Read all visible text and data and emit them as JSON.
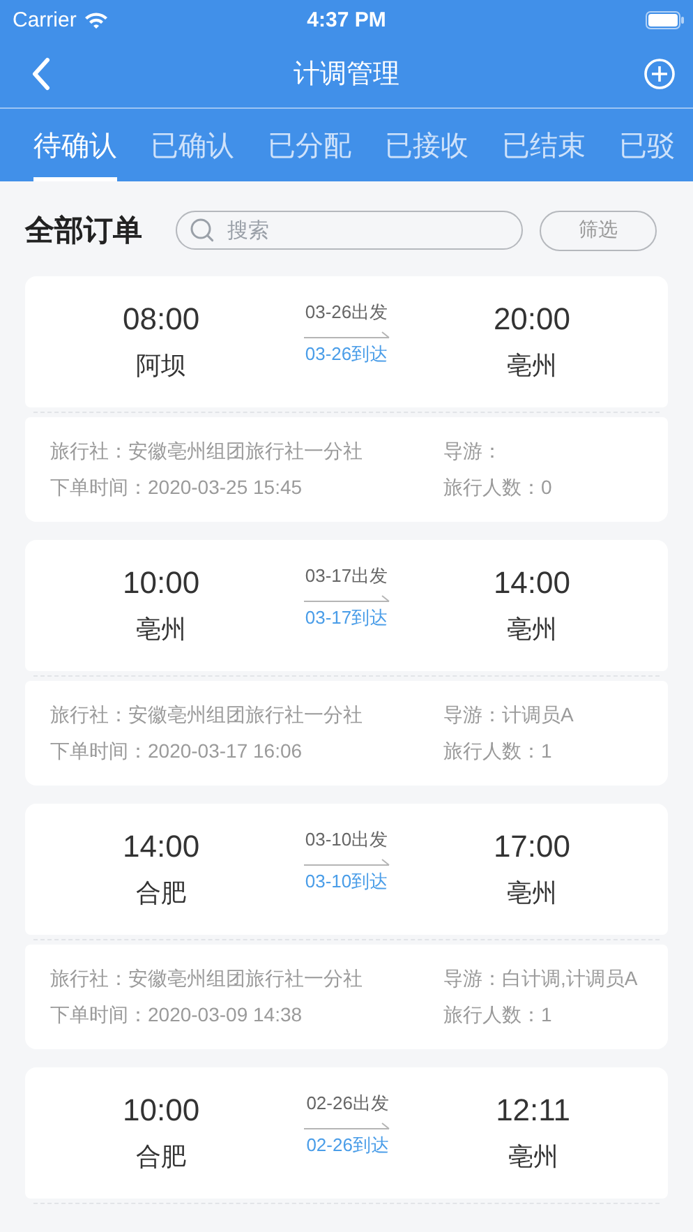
{
  "status_bar": {
    "carrier": "Carrier",
    "time": "4:37 PM"
  },
  "nav": {
    "title": "计调管理"
  },
  "tabs": [
    {
      "label": "待确认",
      "selected": true
    },
    {
      "label": "已确认",
      "selected": false
    },
    {
      "label": "已分配",
      "selected": false
    },
    {
      "label": "已接收",
      "selected": false
    },
    {
      "label": "已结束",
      "selected": false
    },
    {
      "label": "已驳",
      "selected": false
    }
  ],
  "header": {
    "title": "全部订单",
    "search": {
      "placeholder": "搜索"
    },
    "filter": "筛选"
  },
  "orders": [
    {
      "depart_time": "08:00",
      "from": "阿坝",
      "depart_date": "03-26出发",
      "arrive_date": "03-26到达",
      "arrive_time": "20:00",
      "to": "亳州",
      "agency": "旅行社：安徽亳州组团旅行社一分社",
      "order_time": "下单时间：2020-03-25 15:45",
      "guide": "导游：",
      "travelers": "旅行人数：0"
    },
    {
      "depart_time": "10:00",
      "from": "亳州",
      "depart_date": "03-17出发",
      "arrive_date": "03-17到达",
      "arrive_time": "14:00",
      "to": "亳州",
      "agency": "旅行社：安徽亳州组团旅行社一分社",
      "order_time": "下单时间：2020-03-17 16:06",
      "guide": "导游：计调员A",
      "travelers": "旅行人数：1"
    },
    {
      "depart_time": "14:00",
      "from": "合肥",
      "depart_date": "03-10出发",
      "arrive_date": "03-10到达",
      "arrive_time": "17:00",
      "to": "亳州",
      "agency": "旅行社：安徽亳州组团旅行社一分社",
      "order_time": "下单时间：2020-03-09 14:38",
      "guide": "导游：白计调,计调员A",
      "travelers": "旅行人数：1"
    },
    {
      "depart_time": "10:00",
      "from": "合肥",
      "depart_date": "02-26出发",
      "arrive_date": "02-26到达",
      "arrive_time": "12:11",
      "to": "亳州"
    }
  ]
}
